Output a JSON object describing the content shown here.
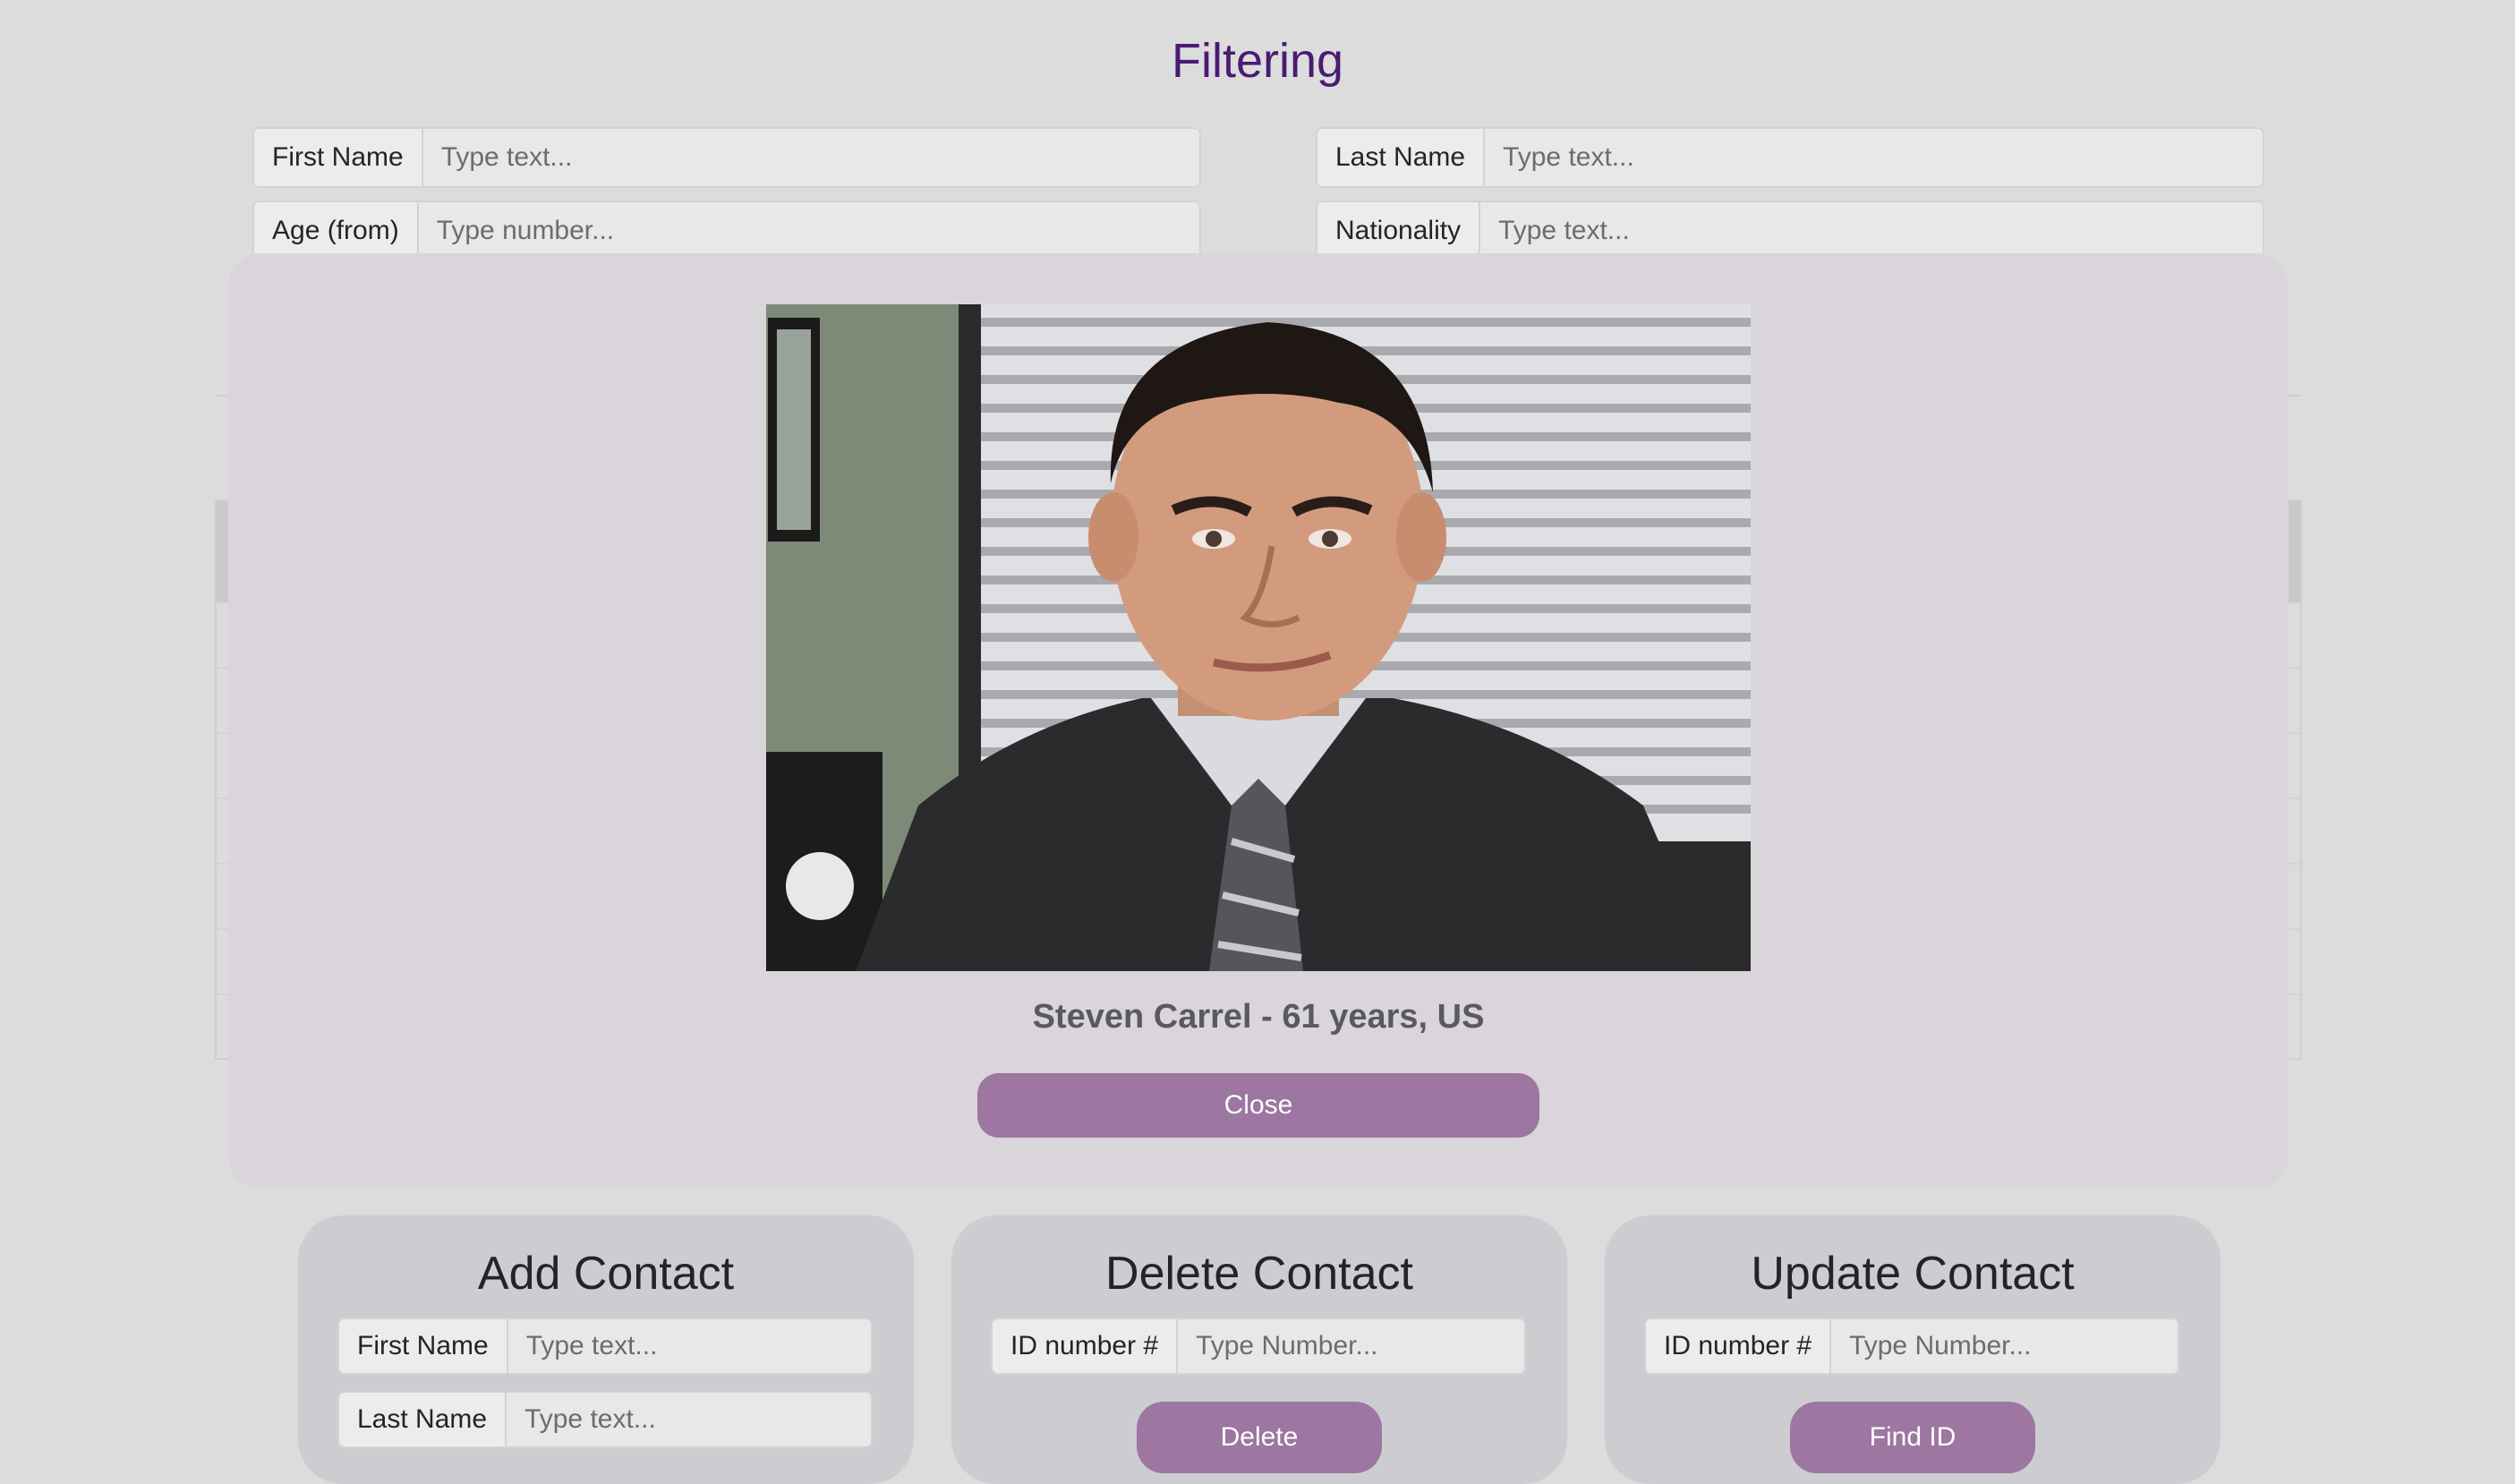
{
  "filtering": {
    "title": "Filtering",
    "first_name": {
      "label": "First Name",
      "placeholder": "Type text..."
    },
    "last_name": {
      "label": "Last Name",
      "placeholder": "Type text..."
    },
    "age_from": {
      "label": "Age (from)",
      "placeholder": "Type number..."
    },
    "nationality": {
      "label": "Nationality",
      "placeholder": "Type text..."
    }
  },
  "modal": {
    "caption": "Steven Carrel - 61 years, US",
    "close_label": "Close"
  },
  "add_contact": {
    "title": "Add Contact",
    "first_name": {
      "label": "First Name",
      "placeholder": "Type text..."
    },
    "last_name": {
      "label": "Last Name",
      "placeholder": "Type text..."
    }
  },
  "delete_contact": {
    "title": "Delete Contact",
    "id": {
      "label": "ID number #",
      "placeholder": "Type Number..."
    },
    "button_label": "Delete"
  },
  "update_contact": {
    "title": "Update Contact",
    "id": {
      "label": "ID number #",
      "placeholder": "Type Number..."
    },
    "button_label": "Find ID"
  },
  "colors": {
    "title": "#4b1a73",
    "button": "#9d76a1",
    "modal_bg": "#dad5da",
    "card_bg": "#cdcdd1"
  }
}
